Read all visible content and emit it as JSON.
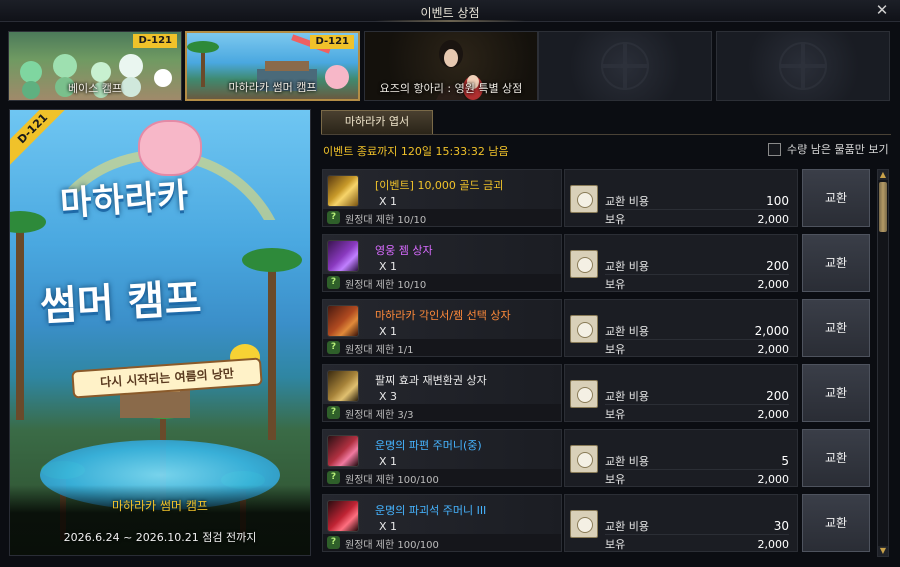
{
  "window": {
    "title": "이벤트 상점"
  },
  "event_tabs": [
    {
      "label": "베이스 캠프",
      "badge": "D-121"
    },
    {
      "label": "마하라카 썸머 캠프",
      "badge": "D-121"
    },
    {
      "label": "요즈의 항아리 : 영원 특별 상점",
      "badge": ""
    }
  ],
  "banner": {
    "badge": "D-121",
    "title_line1": "마하라카",
    "title_line2": "썸머 캠프",
    "subtitle": "다시 시작되는 여름의 낭만",
    "event_name": "마하라카 썸머 캠프",
    "period": "2026.6.24 ~ 2026.10.21 점검 전까지"
  },
  "shop": {
    "tab_label": "마하라카 엽서",
    "remaining": "이벤트 종료까지 120일 15:33:32 남음",
    "filter_label": "수량 남은 물품만 보기",
    "cost_label": "교환 비용",
    "owned_label": "보유",
    "exchange_label": "교환",
    "items": [
      {
        "name": "[이벤트] 10,000 골드 금괴",
        "qty": "X 1",
        "limit": "원정대 제한 10/10",
        "cost": "100",
        "owned": "2,000",
        "name_color": "#f0c22a",
        "icon": "gold-bar-icon"
      },
      {
        "name": "영웅 젬 상자",
        "qty": "X 1",
        "limit": "원정대 제한 10/10",
        "cost": "200",
        "owned": "2,000",
        "name_color": "#d86bff",
        "icon": "gem-chest-icon"
      },
      {
        "name": "마하라카 각인서/젬 선택 상자",
        "qty": "X 1",
        "limit": "원정대 제한 1/1",
        "cost": "2,000",
        "owned": "2,000",
        "name_color": "#ff8a3a",
        "icon": "engraving-chest-icon"
      },
      {
        "name": "팔찌 효과 재변환권 상자",
        "qty": "X 3",
        "limit": "원정대 제한 3/3",
        "cost": "200",
        "owned": "2,000",
        "name_color": "#e8e8e8",
        "icon": "bracelet-chest-icon"
      },
      {
        "name": "운명의 파편 주머니(중)",
        "qty": "X 1",
        "limit": "원정대 제한 100/100",
        "cost": "5",
        "owned": "2,000",
        "name_color": "#46b4ff",
        "icon": "shard-pouch-icon"
      },
      {
        "name": "운명의 파괴석 주머니 III",
        "qty": "X 1",
        "limit": "원정대 제한 100/100",
        "cost": "30",
        "owned": "2,000",
        "name_color": "#46b4ff",
        "icon": "destruction-stone-pouch-icon"
      }
    ]
  }
}
